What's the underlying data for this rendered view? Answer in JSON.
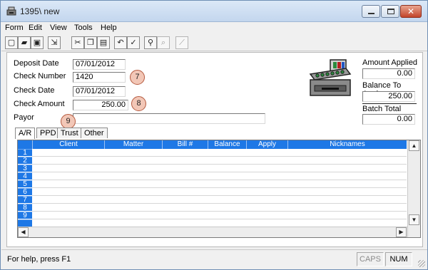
{
  "window": {
    "title": "1395\\ new",
    "icon": "cash-register-icon"
  },
  "menu": [
    "Form",
    "Edit",
    "View",
    "Tools",
    "Help"
  ],
  "toolbar": {
    "icons": [
      "new-document-icon",
      "open-folder-icon",
      "save-icon",
      "open-in-icon",
      "cut-icon",
      "copy-icon",
      "paste-icon",
      "undo-icon",
      "spellcheck-icon",
      "find-icon",
      "search-icon",
      "magic-wand-icon"
    ]
  },
  "form": {
    "deposit_date": {
      "label": "Deposit Date",
      "value": "07/01/2012"
    },
    "check_number": {
      "label": "Check Number",
      "value": "1420"
    },
    "check_date": {
      "label": "Check Date",
      "value": "07/01/2012"
    },
    "check_amount": {
      "label": "Check Amount",
      "value": "250.00"
    },
    "payor": {
      "label": "Payor",
      "value": ""
    }
  },
  "callouts": [
    "7",
    "8",
    "9"
  ],
  "summary": {
    "amount_applied": {
      "label": "Amount Applied",
      "value": "0.00"
    },
    "balance_to_apply": {
      "label": "Balance To Apply",
      "value": "250.00"
    },
    "batch_total": {
      "label": "Batch Total",
      "value": "0.00"
    }
  },
  "tabs": [
    "A/R",
    "PPD",
    "Trust",
    "Other"
  ],
  "grid": {
    "columns": [
      "Client",
      "Matter",
      "Bill #",
      "Balance",
      "Apply",
      "Nicknames"
    ],
    "rows": [
      "1",
      "2",
      "3",
      "4",
      "5",
      "6",
      "7",
      "8",
      "9"
    ]
  },
  "status": {
    "help": "For help, press F1",
    "caps": "CAPS",
    "num": "NUM"
  },
  "colors": {
    "grid_header": "#1e78e6",
    "callout_fill": "#f2c7b7",
    "callout_border": "#b55a3f"
  }
}
